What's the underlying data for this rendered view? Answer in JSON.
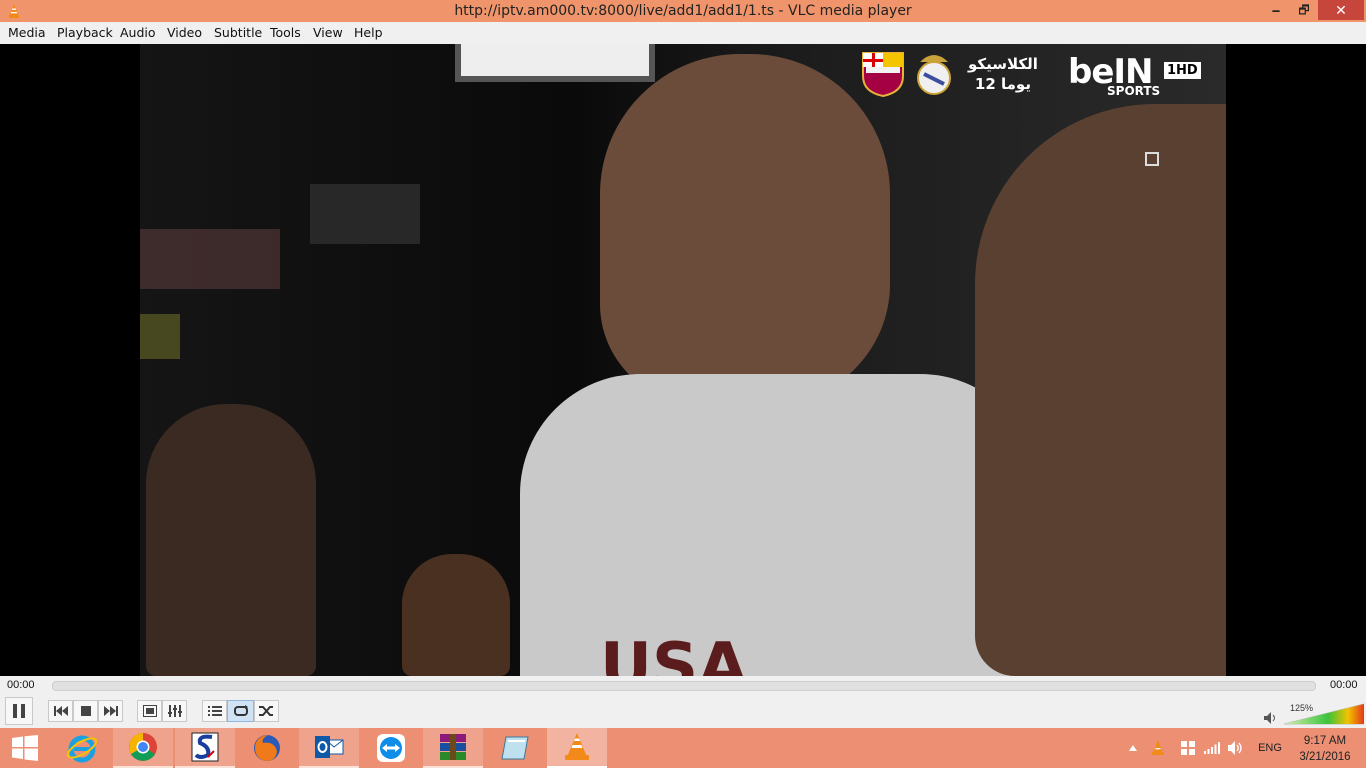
{
  "window": {
    "title": "http://iptv.am000.tv:8000/live/add1/add1/1.ts - VLC media player",
    "minimize_glyph": "🗕",
    "maximize_glyph": "🗗",
    "close_glyph": "✕"
  },
  "menu": {
    "items": [
      "Media",
      "Playback",
      "Audio",
      "Video",
      "Subtitle",
      "Tools",
      "View",
      "Help"
    ]
  },
  "video": {
    "overlay": {
      "arabic_title": "الكلاسيكو",
      "arabic_countdown": "12 يوما",
      "channel_brand": "beIN",
      "channel_hd": "1HD",
      "channel_sub": "SPORTS",
      "jersey_text": "USA"
    }
  },
  "playback": {
    "elapsed": "00:00",
    "total": "00:00",
    "progress": 0
  },
  "controls": {
    "volume_percent": "125%",
    "volume_level": 1.25
  },
  "taskbar": {
    "apps": [
      {
        "name": "start",
        "icon": "windows-logo-icon"
      },
      {
        "name": "internet-explorer",
        "icon": "internet-explorer-icon"
      },
      {
        "name": "chrome",
        "icon": "chrome-icon"
      },
      {
        "name": "app-s",
        "icon": "s-app-icon"
      },
      {
        "name": "firefox",
        "icon": "firefox-icon"
      },
      {
        "name": "outlook",
        "icon": "outlook-icon"
      },
      {
        "name": "teamviewer",
        "icon": "teamviewer-icon"
      },
      {
        "name": "winrar",
        "icon": "winrar-icon"
      },
      {
        "name": "notepad",
        "icon": "notepad-icon"
      },
      {
        "name": "vlc",
        "icon": "vlc-icon"
      }
    ],
    "tray": {
      "language": "ENG",
      "time": "9:17 AM",
      "date": "3/21/2016"
    }
  },
  "colors": {
    "titlebar": "#f0956b",
    "taskbar": "#ec8f73",
    "close_button": "#c7463b",
    "vlc_orange": "#f28a1a"
  }
}
